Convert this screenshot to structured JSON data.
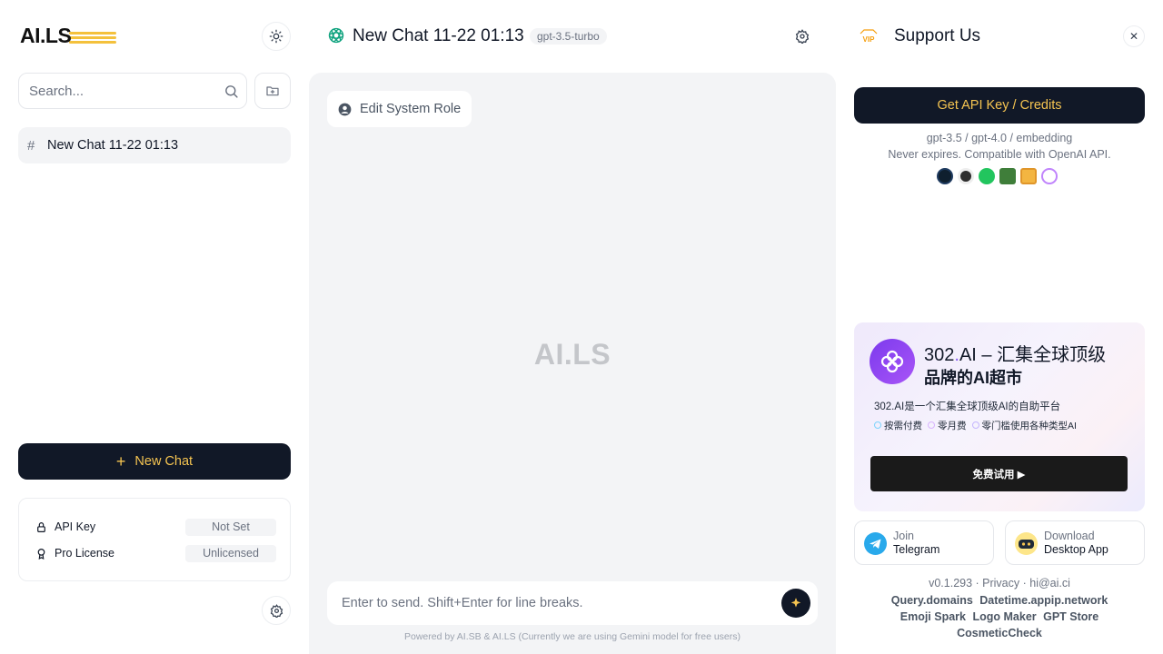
{
  "sidebar": {
    "logo_text": "AI.LS",
    "search_placeholder": "Search...",
    "chats": [
      {
        "title": "New Chat 11-22 01:13"
      }
    ],
    "new_chat_label": "New Chat",
    "settings": [
      {
        "name": "API Key",
        "value": "Not Set",
        "icon": "lock-icon"
      },
      {
        "name": "Pro License",
        "value": "Unlicensed",
        "icon": "badge-icon"
      }
    ]
  },
  "chat": {
    "title": "New Chat 11-22 01:13",
    "model": "gpt-3.5-turbo",
    "edit_role_label": "Edit System Role",
    "watermark": "AI.LS",
    "input_placeholder": "Enter to send. Shift+Enter for line breaks.",
    "powered_by": "Powered by AI.SB & AI.LS (Currently we are using Gemini model for free users)"
  },
  "support": {
    "vip_badge": "VIP",
    "title": "Support Us",
    "api_button": "Get API Key / Credits",
    "api_line1": "gpt-3.5 / gpt-4.0 / embedding",
    "api_line2": "Never expires. Compatible with OpenAI API.",
    "brand_icons": [
      "code-icon",
      "cat-icon",
      "chat-bubble-icon",
      "translate-icon",
      "slides-icon",
      "openai-icon"
    ],
    "promo": {
      "name": "302",
      "dot": ".",
      "ai": "AI",
      "title_rest": " – 汇集全球顶级",
      "title_line2": "品牌的AI超市",
      "desc": "302.AI是一个汇集全球顶级AI的自助平台",
      "tags": [
        "按需付费",
        "零月费",
        "零门槛使用各种类型AI"
      ],
      "button": "免费试用 ▶"
    },
    "telegram": {
      "line1": "Join",
      "line2": "Telegram"
    },
    "desktop": {
      "line1": "Download",
      "line2": "Desktop App"
    },
    "version": "v0.1.293 · Privacy · hi@ai.ci",
    "footer_links": [
      "Query.domains",
      "Datetime.appip.network",
      "Emoji Spark",
      "Logo Maker",
      "GPT Store",
      "CosmeticCheck"
    ]
  },
  "colors": {
    "accent_dark": "#111827",
    "accent_gold": "#f5c451",
    "panel_bg": "#f3f4f6"
  }
}
